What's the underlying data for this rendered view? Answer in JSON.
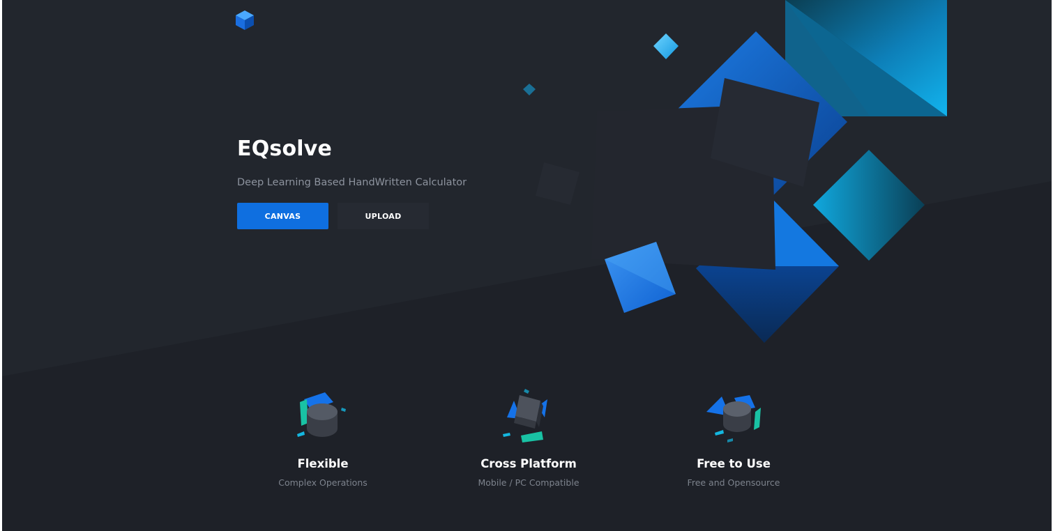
{
  "hero": {
    "title": "EQsolve",
    "subtitle": "Deep Learning Based HandWritten Calculator",
    "buttons": {
      "canvas_label": "CANVAS",
      "upload_label": "UPLOAD"
    }
  },
  "features": [
    {
      "title": "Flexible",
      "subtitle": "Complex Operations",
      "icon": "cylinder-shapes-icon"
    },
    {
      "title": "Cross Platform",
      "subtitle": "Mobile / PC Compatible",
      "icon": "cube-shapes-icon"
    },
    {
      "title": "Free to Use",
      "subtitle": "Free and Opensource",
      "icon": "cylinder-shapes-icon"
    }
  ],
  "colors": {
    "background": "#1e2128",
    "accent_blue": "#0f6fe0",
    "accent_cyan": "#0fa0d8",
    "accent_teal": "#19c2a4",
    "secondary_button": "#262a32",
    "muted_text": "#8d939e"
  },
  "icons": {
    "logo": "blue-cube-logo-icon"
  }
}
